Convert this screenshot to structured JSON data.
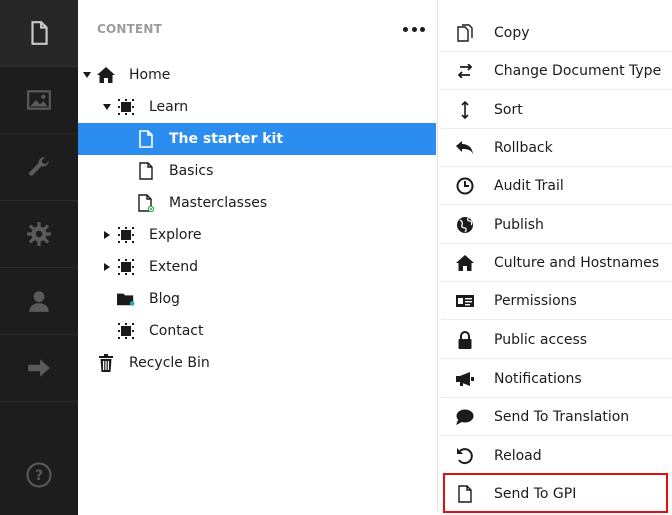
{
  "tree": {
    "header": "CONTENT",
    "nodes": [
      {
        "label": "Home"
      },
      {
        "label": "Learn"
      },
      {
        "label": "The starter kit"
      },
      {
        "label": "Basics"
      },
      {
        "label": "Masterclasses"
      },
      {
        "label": "Explore"
      },
      {
        "label": "Extend"
      },
      {
        "label": "Blog"
      },
      {
        "label": "Contact"
      },
      {
        "label": "Recycle Bin"
      }
    ]
  },
  "menu": {
    "items": [
      {
        "label": "Copy",
        "icon": "copy-icon"
      },
      {
        "label": "Change Document Type",
        "icon": "swap-icon"
      },
      {
        "label": "Sort",
        "icon": "sort-icon"
      },
      {
        "label": "Rollback",
        "icon": "undo-icon"
      },
      {
        "label": "Audit Trail",
        "icon": "clock-icon"
      },
      {
        "label": "Publish",
        "icon": "globe-icon"
      },
      {
        "label": "Culture and Hostnames",
        "icon": "home-icon"
      },
      {
        "label": "Permissions",
        "icon": "id-card-icon"
      },
      {
        "label": "Public access",
        "icon": "lock-icon"
      },
      {
        "label": "Notifications",
        "icon": "megaphone-icon"
      },
      {
        "label": "Send To Translation",
        "icon": "chat-icon"
      },
      {
        "label": "Reload",
        "icon": "reload-icon"
      },
      {
        "label": "Send To GPI",
        "icon": "document-icon"
      }
    ]
  },
  "colors": {
    "rail_bg": "#1d1d1d",
    "selected_bg": "#2c8df0",
    "highlight_border": "#e01010"
  }
}
